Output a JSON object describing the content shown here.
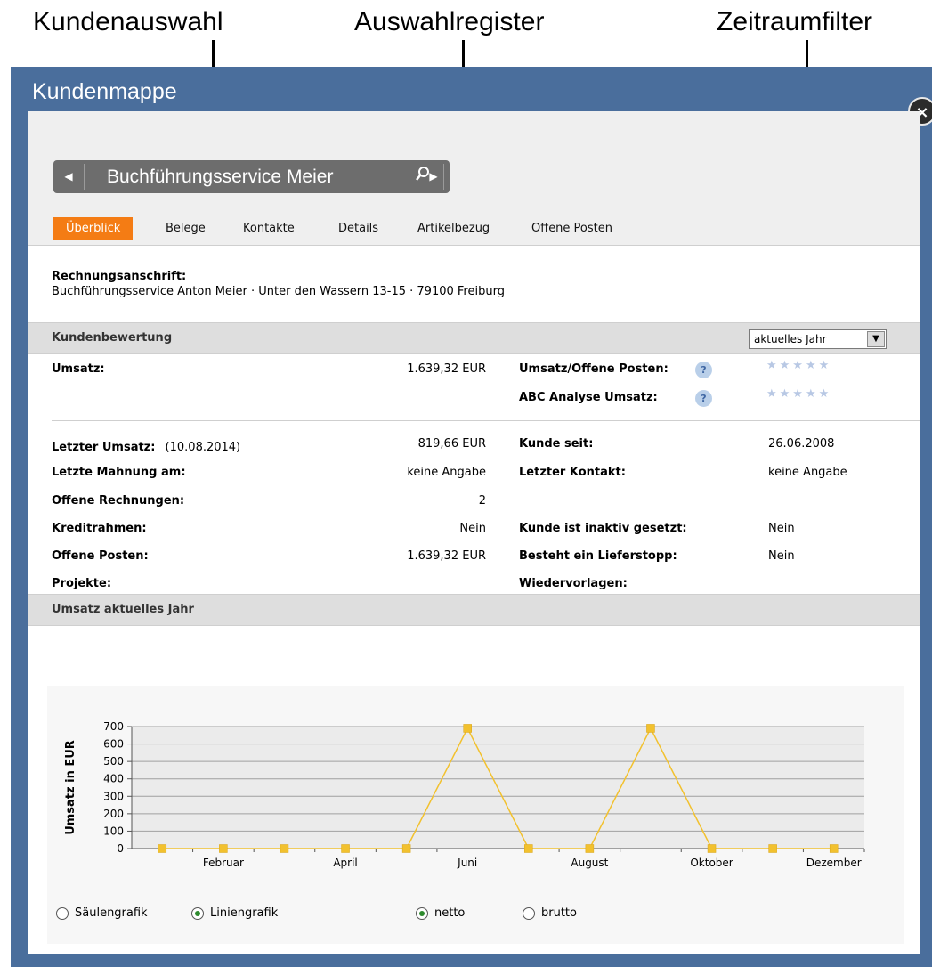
{
  "callouts": {
    "customer_select": "Kundenauswahl",
    "tab_register": "Auswahlregister",
    "period_filter": "Zeitraumfilter"
  },
  "window": {
    "title": "Kundenmappe",
    "close_icon": "×"
  },
  "selector": {
    "customer_name": "Buchführungsservice Meier"
  },
  "tabs": [
    "Überblick",
    "Belege",
    "Kontakte",
    "Details",
    "Artikelbezug",
    "Offene Posten"
  ],
  "address": {
    "label": "Rechnungsanschrift:",
    "value": "Buchführungsservice Anton Meier · Unter den Wassern 13-15 · 79100 Freiburg"
  },
  "rating": {
    "title": "Kundenbewertung",
    "period_selected": "aktuelles Jahr",
    "umsatz_label": "Umsatz:",
    "umsatz_value": "1.639,32 EUR",
    "op_label": "Umsatz/Offene Posten:",
    "abc_label": "ABC Analyse Umsatz:",
    "help_glyph": "?"
  },
  "details": {
    "left": [
      {
        "label": "Letzter Umsatz:",
        "extra": "(10.08.2014)",
        "value": "819,66 EUR"
      },
      {
        "label": "Letzte Mahnung am:",
        "extra": "",
        "value": "keine Angabe"
      },
      {
        "label": "Offene Rechnungen:",
        "extra": "",
        "value": "2"
      },
      {
        "label": "Kreditrahmen:",
        "extra": "",
        "value": "Nein"
      },
      {
        "label": "Offene Posten:",
        "extra": "",
        "value": "1.639,32 EUR"
      },
      {
        "label": "Projekte:",
        "extra": "",
        "value": ""
      }
    ],
    "right": [
      {
        "label": "Kunde seit:",
        "value": "26.06.2008"
      },
      {
        "label": "Letzter Kontakt:",
        "value": "keine Angabe"
      },
      {
        "label": "",
        "value": ""
      },
      {
        "label": "Kunde ist inaktiv gesetzt:",
        "value": "Nein"
      },
      {
        "label": "Besteht ein Lieferstopp:",
        "value": "Nein"
      },
      {
        "label": "Wiedervorlagen:",
        "value": ""
      }
    ]
  },
  "revenue_section": {
    "title": "Umsatz aktuelles Jahr"
  },
  "chart_data": {
    "type": "line",
    "ylabel": "Umsatz in EUR",
    "xlabel": "",
    "ylim": [
      0,
      700
    ],
    "yticks": [
      0,
      100,
      200,
      300,
      400,
      500,
      600,
      700
    ],
    "x_tick_labels": [
      "Februar",
      "April",
      "Juni",
      "August",
      "Oktober",
      "Dezember"
    ],
    "categories": [
      "Januar",
      "Februar",
      "März",
      "April",
      "Mai",
      "Juni",
      "Juli",
      "August",
      "September",
      "Oktober",
      "November",
      "Dezember"
    ],
    "values": [
      0,
      0,
      0,
      0,
      0,
      690,
      0,
      0,
      690,
      0,
      0,
      0
    ],
    "line_color": "#f2c12e",
    "grid": true
  },
  "chart_options": {
    "saeulen": "Säulengrafik",
    "linien": "Liniengrafik",
    "netto": "netto",
    "brutto": "brutto"
  }
}
